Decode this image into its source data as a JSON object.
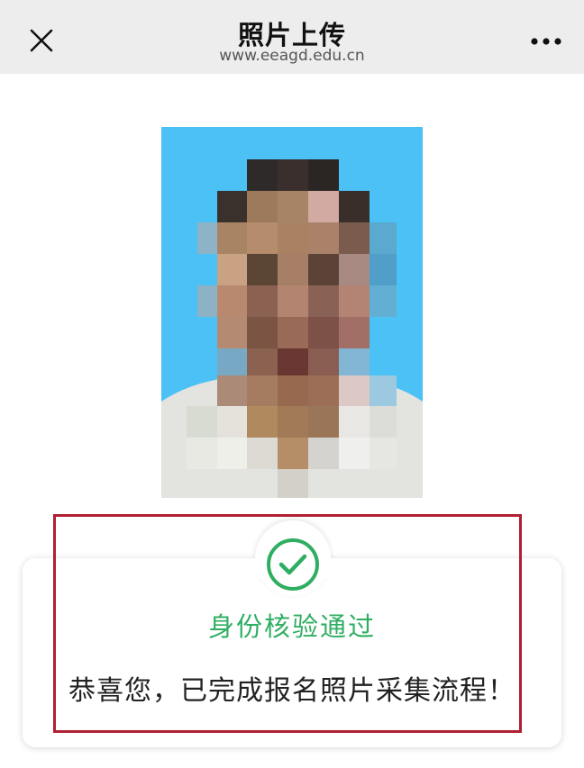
{
  "navbar": {
    "title": "照片上传",
    "subtitle": "www.eeagd.edu.cn",
    "close_icon": "close-icon",
    "more_icon": "more-dots-icon"
  },
  "photo": {
    "description_icon": "pixelated-portrait",
    "background_color": "#4bc1f5"
  },
  "result": {
    "status_icon": "check-circle-icon",
    "status_color": "#2fae62",
    "title": "身份核验通过",
    "message": "恭喜您，已完成报名照片采集流程！",
    "highlight_color": "#b01f32"
  }
}
